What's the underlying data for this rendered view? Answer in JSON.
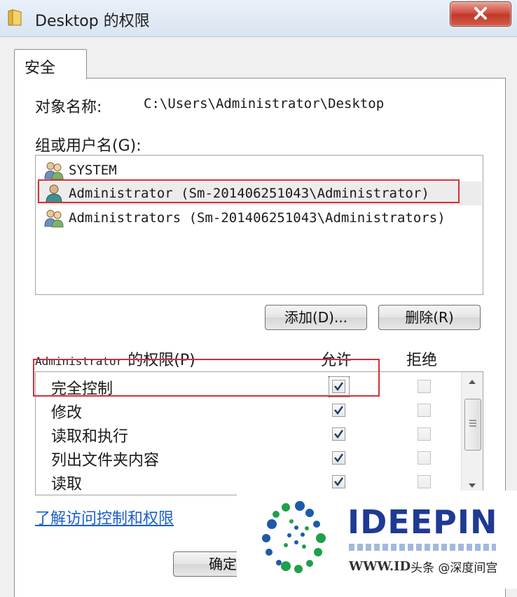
{
  "window": {
    "title": "Desktop 的权限",
    "close_icon": "close-icon",
    "folder_icon": "folder-icon"
  },
  "tabs": [
    {
      "label": "安全",
      "selected": true
    }
  ],
  "object": {
    "label": "对象名称:",
    "value": "C:\\Users\\Administrator\\Desktop"
  },
  "groups": {
    "label": "组或用户名(G):",
    "users": [
      {
        "name": "SYSTEM",
        "icon": "group-users-icon",
        "selected": false
      },
      {
        "name": "Administrator (Sm-201406251043\\Administrator)",
        "icon": "user-icon",
        "selected": true
      },
      {
        "name": "Administrators (Sm-201406251043\\Administrators)",
        "icon": "group-users-icon",
        "selected": false
      }
    ]
  },
  "buttons": {
    "add": "添加(D)...",
    "remove": "删除(R)",
    "ok": "确定"
  },
  "permissions": {
    "principal": "Administrator",
    "title_suffix": "的权限(P)",
    "allow_label": "允许",
    "deny_label": "拒绝",
    "items": [
      {
        "name": "完全控制",
        "allow": true,
        "deny": false
      },
      {
        "name": "修改",
        "allow": true,
        "deny": false
      },
      {
        "name": "读取和执行",
        "allow": true,
        "deny": false
      },
      {
        "name": "列出文件夹内容",
        "allow": true,
        "deny": false
      },
      {
        "name": "读取",
        "allow": true,
        "deny": false
      }
    ]
  },
  "help_link": "了解访问控制和权限",
  "watermark": {
    "brand": "IDEEPIN",
    "url": "WWW.ID",
    "caption": "头条 @深度间宫"
  },
  "colors": {
    "highlight_box": "#d2303a",
    "link": "#1a5ec8",
    "brand": "#1e3a93"
  }
}
